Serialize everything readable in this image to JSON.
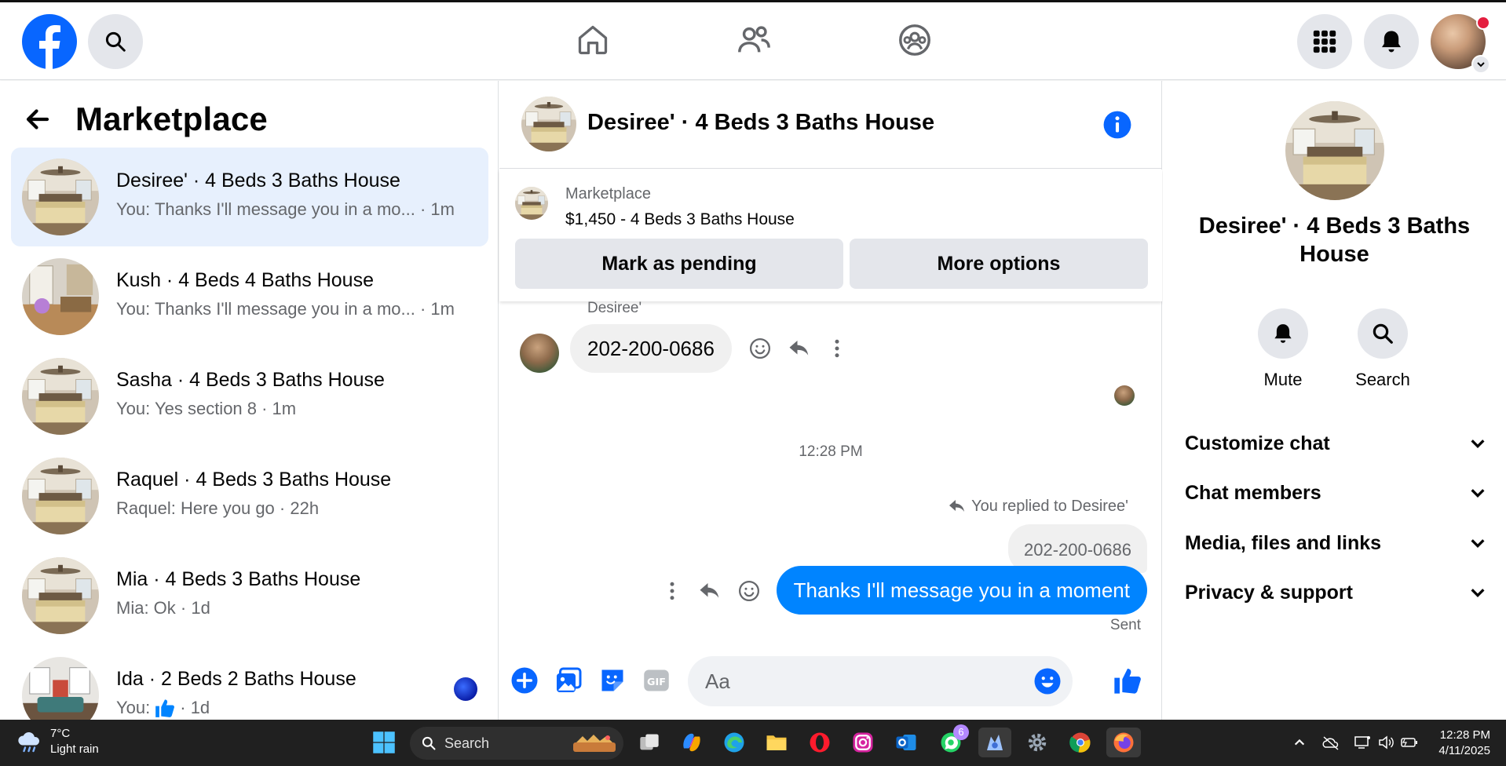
{
  "top_nav": {
    "search_label": "Search",
    "notifications_label": "Notifications",
    "menu_label": "Menu"
  },
  "left": {
    "title": "Marketplace",
    "conversations": [
      {
        "name": "Desiree' · 4 Beds 3 Baths House",
        "snippet": "You: Thanks I'll message you in a mo... · 1m",
        "active": true
      },
      {
        "name": "Kush · 4 Beds 4 Baths House",
        "snippet": "You: Thanks I'll message you in a mo... · 1m",
        "active": false
      },
      {
        "name": "Sasha · 4 Beds 3 Baths House",
        "snippet": "You: Yes section 8 · 1m",
        "active": false
      },
      {
        "name": "Raquel · 4 Beds 3 Baths House",
        "snippet": "Raquel: Here you go · 22h",
        "active": false
      },
      {
        "name": "Mia · 4 Beds 3 Baths House",
        "snippet": "Mia: Ok · 1d",
        "active": false
      },
      {
        "name": "Ida · 2 Beds 2 Baths House",
        "snippet_prefix": "You:",
        "snippet_suffix": "· 1d",
        "active": false
      }
    ]
  },
  "chat": {
    "title": "Desiree' · 4 Beds 3 Baths House",
    "listing_label": "Marketplace",
    "listing_price": "$1,450 - 4 Beds 3 Baths House",
    "mark_pending": "Mark as pending",
    "more_options": "More options",
    "sender_name": "Desiree'",
    "incoming_message": "202-200-0686",
    "timestamp": "12:28 PM",
    "replied_to": "You replied to Desiree'",
    "quoted_message": "202-200-0686",
    "outgoing_message": "Thanks I'll message you in a moment",
    "status": "Sent",
    "composer_placeholder": "Aa"
  },
  "details": {
    "title": "Desiree' · 4 Beds 3 Baths House",
    "mute": "Mute",
    "search": "Search",
    "sections": [
      "Customize chat",
      "Chat members",
      "Media, files and links",
      "Privacy & support"
    ]
  },
  "taskbar": {
    "temperature": "7°C",
    "weather": "Light rain",
    "search": "Search",
    "whatsapp_badge": "6",
    "time": "12:28 PM",
    "date": "4/11/2025"
  },
  "colors": {
    "brand_blue": "#0866ff",
    "messenger_blue": "#0084ff",
    "active_row": "#e7f0fd",
    "gray_button": "#e4e6eb"
  }
}
